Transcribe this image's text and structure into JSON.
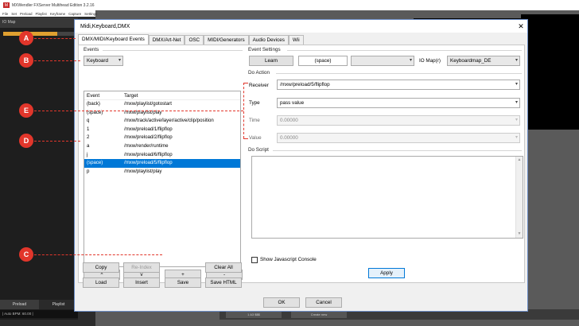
{
  "background_app": {
    "title": "MXWendler FXServer Multihead Edition 3.2.16",
    "menu": [
      "File",
      "Set",
      "Preload",
      "Playlist",
      "Keyframe",
      "Capture",
      "Settings"
    ],
    "panel_title": "IO Map",
    "left_tabs": [
      "Preload",
      "Playlist"
    ],
    "status": "| Auto BPM: 60.00 |",
    "bottom_items": [
      "1 A3 $$$",
      "Create new"
    ]
  },
  "dialog": {
    "title": "Midi,Keyboard,DMX",
    "close_label": "✕",
    "tabs": [
      "DMX/MIDI/Keyboard Events",
      "DMX/Art-Net",
      "OSC",
      "MIDI/Generators",
      "Audio Devices",
      "Wii"
    ],
    "active_tab": 0
  },
  "events": {
    "section_label": "Events",
    "device_combo": "Keyboard",
    "columns": [
      "Event",
      "Target"
    ],
    "rows": [
      {
        "event": "(back)",
        "target": "/mxw/playlist/gotostart"
      },
      {
        "event": "(space)",
        "target": "/mxw/playlist/play"
      },
      {
        "event": "q",
        "target": "/mxw/track/active/layer/active/clip/position"
      },
      {
        "event": "1",
        "target": "/mxw/preload/1/flipflop"
      },
      {
        "event": "2",
        "target": "/mxw/preload/2/flipflop"
      },
      {
        "event": "a",
        "target": "/mxw/render/runtime"
      },
      {
        "event": "j",
        "target": "/mxw/preload/6/flipflop"
      },
      {
        "event": "(space)",
        "target": "/mxw/preload/5/flipflop"
      },
      {
        "event": "p",
        "target": "/mxw/playlist/play"
      }
    ],
    "selected_row": 7,
    "nav_buttons": [
      "^",
      "v",
      "+",
      "-"
    ],
    "row1_buttons": [
      "Copy",
      "Re-Index",
      "Clear All"
    ],
    "row2_buttons": [
      "Load",
      "Insert",
      "Save",
      "Save HTML"
    ]
  },
  "event_settings": {
    "section_label": "Event Settings",
    "learn_label": "Learn",
    "learned_value": "(space)",
    "io_map_label": "IO Map(r)",
    "io_map_value": "Keyboardmap_DE",
    "do_action_label": "Do Action",
    "receiver_label": "Receiver",
    "receiver_value": "/mxw/preload/5/flipflop",
    "type_label": "Type",
    "type_value": "pass value",
    "time_label": "Time",
    "time_value": "0.00000",
    "value_label": "Value",
    "value_value": "0.00000",
    "do_script_label": "Do Script",
    "show_js_label": "Show Javascript Console",
    "apply_label": "Apply"
  },
  "footer": {
    "ok_label": "OK",
    "cancel_label": "Cancel"
  },
  "annotations": [
    "A",
    "B",
    "C",
    "D",
    "E"
  ],
  "colors": {
    "marker": "#e2362b",
    "selection": "#0078d7"
  }
}
